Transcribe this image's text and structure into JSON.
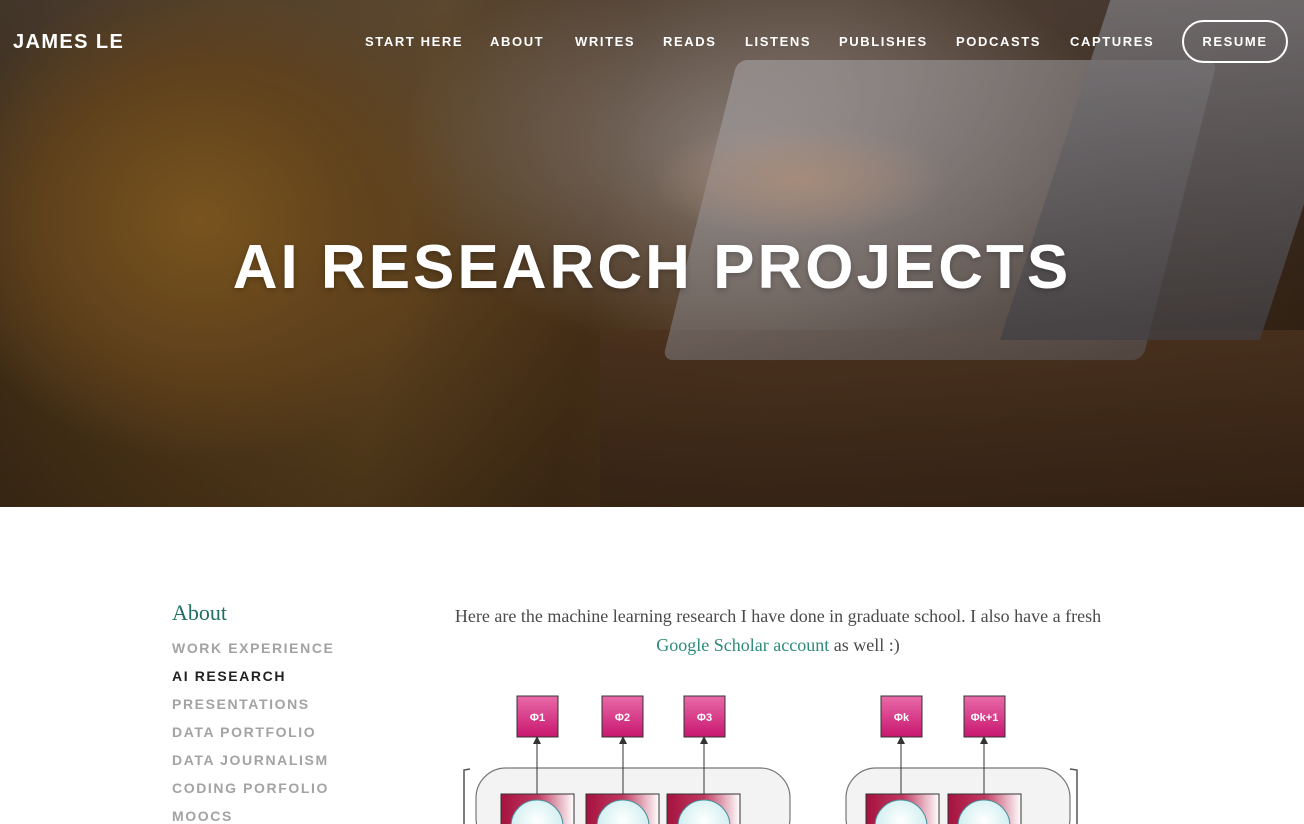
{
  "header": {
    "site_title": "JAMES LE",
    "nav": [
      "START HERE",
      "ABOUT",
      "WRITES",
      "READS",
      "LISTENS",
      "PUBLISHES",
      "PODCASTS",
      "CAPTURES"
    ],
    "resume_label": "RESUME"
  },
  "hero": {
    "title": "AI RESEARCH PROJECTS"
  },
  "sidebar": {
    "heading": "About",
    "items": [
      {
        "label": "WORK EXPERIENCE",
        "active": false
      },
      {
        "label": "AI RESEARCH",
        "active": true
      },
      {
        "label": "PRESENTATIONS",
        "active": false
      },
      {
        "label": "DATA PORTFOLIO",
        "active": false
      },
      {
        "label": "DATA JOURNALISM",
        "active": false
      },
      {
        "label": "CODING PORFOLIO",
        "active": false
      },
      {
        "label": "MOOCS",
        "active": false
      }
    ]
  },
  "main": {
    "intro_before": "Here are the machine learning research I have done in graduate school. I also have a fresh ",
    "intro_link": "Google Scholar account",
    "intro_after": " as well :)"
  },
  "diagram": {
    "labels": [
      "Φ1",
      "Φ2",
      "Φ3",
      "Φk",
      "Φk+1"
    ],
    "colors": {
      "label_box": "#d21f7e",
      "node": "#a5123f",
      "cell": "#cfeeee"
    }
  }
}
